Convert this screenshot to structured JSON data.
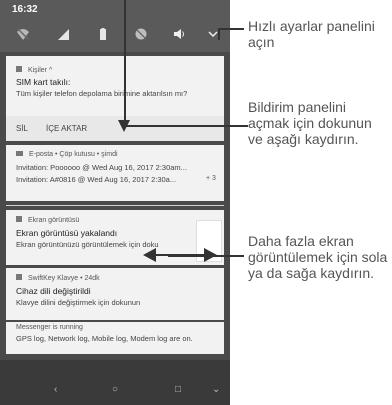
{
  "status": {
    "time": "16:32"
  },
  "quick_settings": {
    "icons": [
      "wifi-off-icon",
      "signal-icon",
      "battery-icon",
      "dnd-icon",
      "volume-icon",
      "chevron-down-icon"
    ]
  },
  "notifications": [
    {
      "app": "Kişiler",
      "meta": "^",
      "title": "SIM kart takılı:",
      "body": "Tüm kişiler telefon depolama birimine aktarılsın mı?",
      "actions": [
        "SİL",
        "İÇE AKTAR"
      ]
    },
    {
      "app": "E-posta",
      "meta": "• Çöp kutusu • şimdi",
      "line1": "Invitation: Poooooo @ Wed Aug 16, 2017 2:30am...",
      "line2": "Invitation: A#0816 @ Wed Aug 16, 2017 2:30a...",
      "extra": "+ 3"
    },
    {
      "app": "Ekran görüntüsü",
      "meta": "",
      "title": "Ekran görüntüsü yakalandı",
      "body": "Ekran görüntünüzü görüntülemek için doku"
    },
    {
      "app": "SwiftKey Klavye",
      "meta": "• 24dk",
      "title": "Cihaz dili değiştirildi",
      "body": "Klavye dilini değiştirmek için dokunun"
    },
    {
      "app": "Messenger",
      "meta": "is running",
      "body": "GPS log, Network log, Mobile log, Modem log are on."
    }
  ],
  "nav": {
    "back": "‹",
    "home": "○",
    "recent": "□",
    "down": "⌄"
  },
  "callouts": [
    {
      "text1": "Hızlı ayarlar panelini",
      "text2": "açın"
    },
    {
      "text1": "Bildirim panelini",
      "text2": "açmak için dokunun",
      "text3": "ve aşağı kaydırın."
    },
    {
      "text1": "Daha fazla ekran",
      "text2": "görüntülemek için sola",
      "text3": "ya da sağa kaydırın."
    }
  ]
}
